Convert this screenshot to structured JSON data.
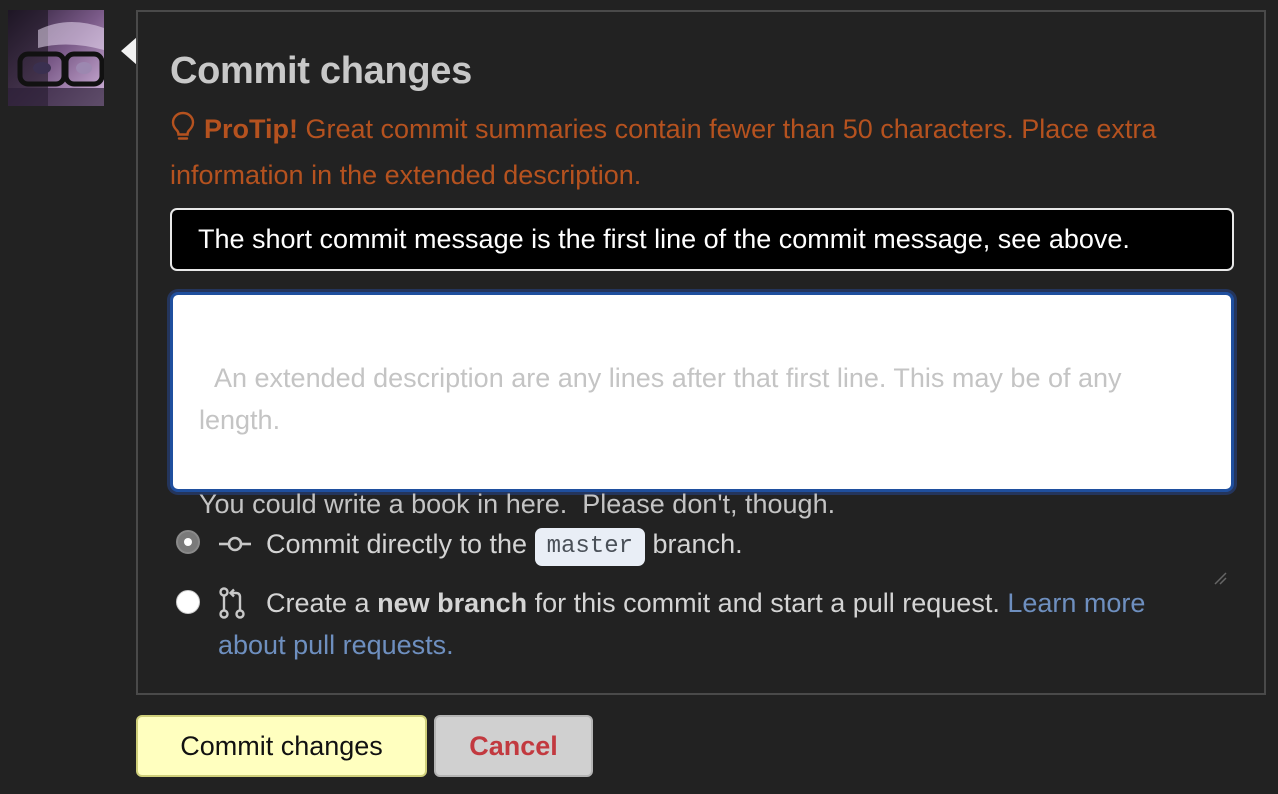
{
  "avatar": {
    "alt": "user avatar"
  },
  "commit_form": {
    "title": "Commit changes",
    "protip_label": "ProTip!",
    "protip_text": "Great commit summaries contain fewer than 50 characters. Place extra information in the extended description.",
    "summary_value": "The short commit message is the first line of the commit message, see above.",
    "description_placeholder": "An extended description are any lines after that first line. This may be of any length.\n\nYou could write a book in here.  Please don't, though."
  },
  "options": {
    "direct": {
      "prefix": "Commit directly to the",
      "branch": "master",
      "suffix": "branch.",
      "selected": true,
      "icon": "git-commit-icon"
    },
    "new_branch": {
      "prefix": "Create a",
      "bold": "new branch",
      "middle": "for this commit and start a pull request.",
      "link_1": "Learn more",
      "link_2": "about pull requests.",
      "selected": false,
      "icon": "git-pull-request-icon"
    }
  },
  "buttons": {
    "commit": "Commit changes",
    "cancel": "Cancel"
  },
  "colors": {
    "background": "#222222",
    "protip": "#b5521f",
    "commit_button": "#ffffbf",
    "cancel_text": "#c2393f",
    "link": "#6e8fbf",
    "focus_border": "#1f4f9e"
  }
}
